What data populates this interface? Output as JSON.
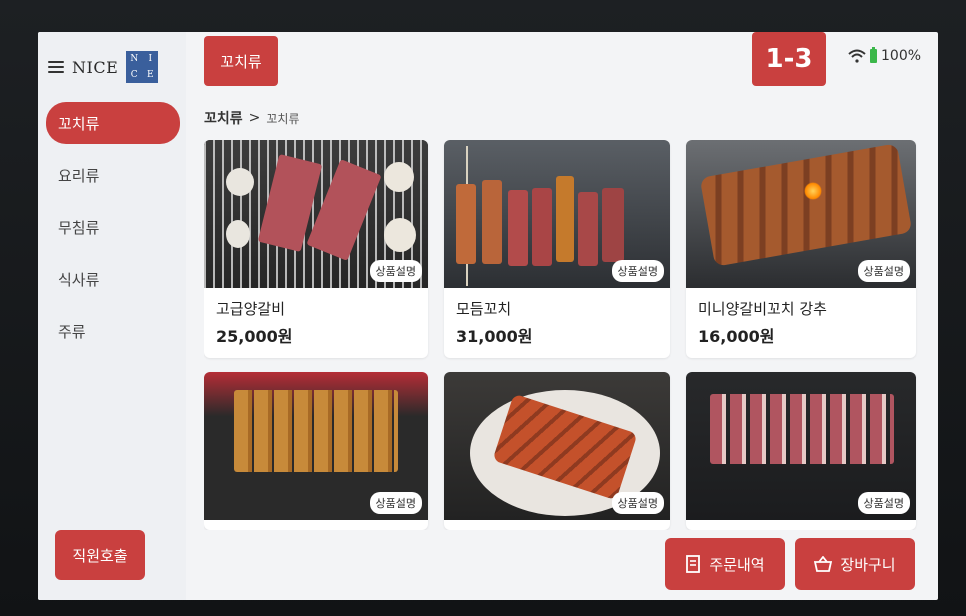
{
  "brand": {
    "name": "NICE",
    "logo_letters": [
      "N",
      "I",
      "C",
      "E"
    ]
  },
  "header": {
    "category_tab": "꼬치류",
    "table_number": "1-3",
    "battery": "100%"
  },
  "sidebar": {
    "items": [
      {
        "label": "꼬치류",
        "active": true
      },
      {
        "label": "요리류",
        "active": false
      },
      {
        "label": "무침류",
        "active": false
      },
      {
        "label": "식사류",
        "active": false
      },
      {
        "label": "주류",
        "active": false
      }
    ],
    "staff_call": "직원호출"
  },
  "breadcrumb": {
    "root": "꼬치류",
    "separator": ">",
    "current": "꼬치류"
  },
  "products": [
    {
      "name": "고급양갈비",
      "price": "25,000원",
      "desc_button": "상품설명"
    },
    {
      "name": "모듬꼬치",
      "price": "31,000원",
      "desc_button": "상품설명"
    },
    {
      "name": "미니양갈비꼬치 강추",
      "price": "16,000원",
      "desc_button": "상품설명"
    },
    {
      "name": "",
      "price": "",
      "desc_button": "상품설명"
    },
    {
      "name": "",
      "price": "",
      "desc_button": "상품설명"
    },
    {
      "name": "",
      "price": "",
      "desc_button": "상품설명"
    }
  ],
  "footer": {
    "order_history": "주문내역",
    "cart": "장바구니"
  },
  "colors": {
    "accent": "#c9403f",
    "battery": "#3bb74a"
  }
}
